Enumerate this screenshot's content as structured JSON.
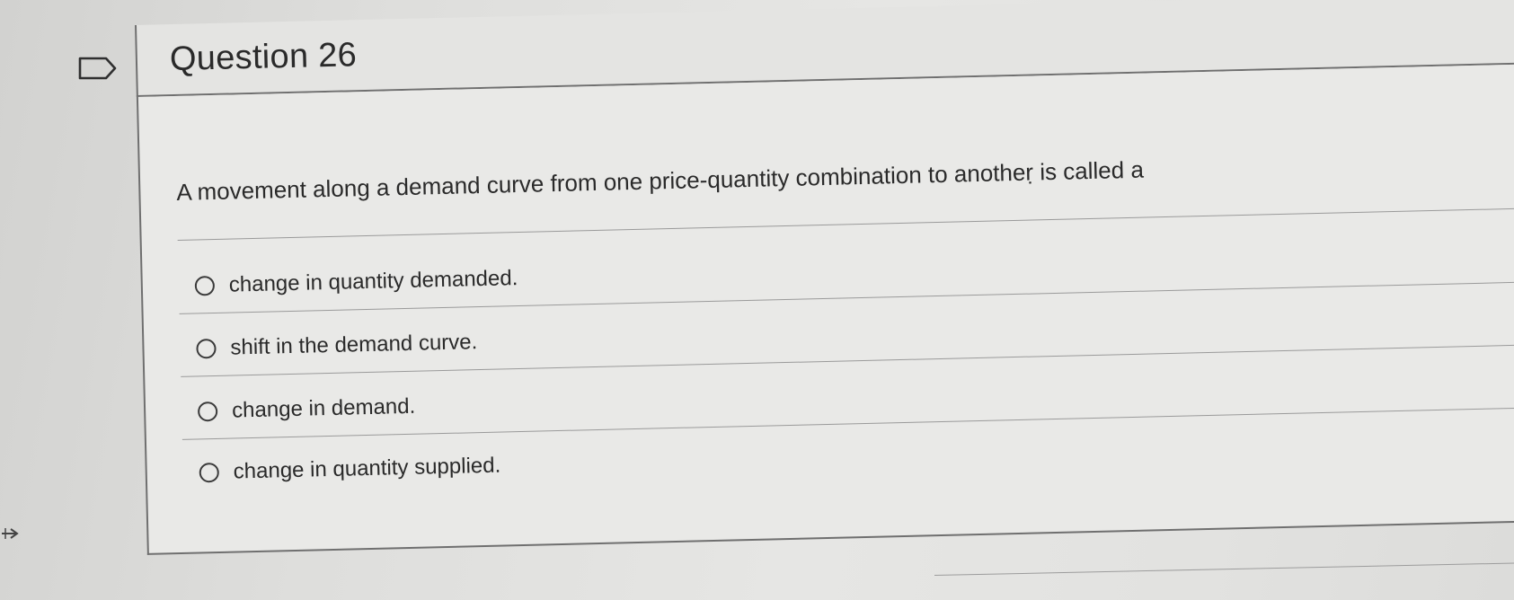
{
  "question": {
    "title": "Question 26",
    "text": "A movement along a demand curve from one price-quantity combination to anotheṛ is called a"
  },
  "choices": [
    {
      "label": "change in quantity demanded.",
      "selected": false
    },
    {
      "label": "shift in the demand curve.",
      "selected": false
    },
    {
      "label": "change in demand.",
      "selected": false
    },
    {
      "label": "change in quantity supplied.",
      "selected": false
    }
  ],
  "icons": {
    "flag": "flag-outline-icon",
    "radio": "radio-unchecked-icon",
    "edge_arrow": "arrow-right-icon"
  },
  "colors": {
    "background": "#d8d8d6",
    "card": "#e9e9e7",
    "text": "#2a2a2a",
    "border": "#6f6f6f"
  }
}
